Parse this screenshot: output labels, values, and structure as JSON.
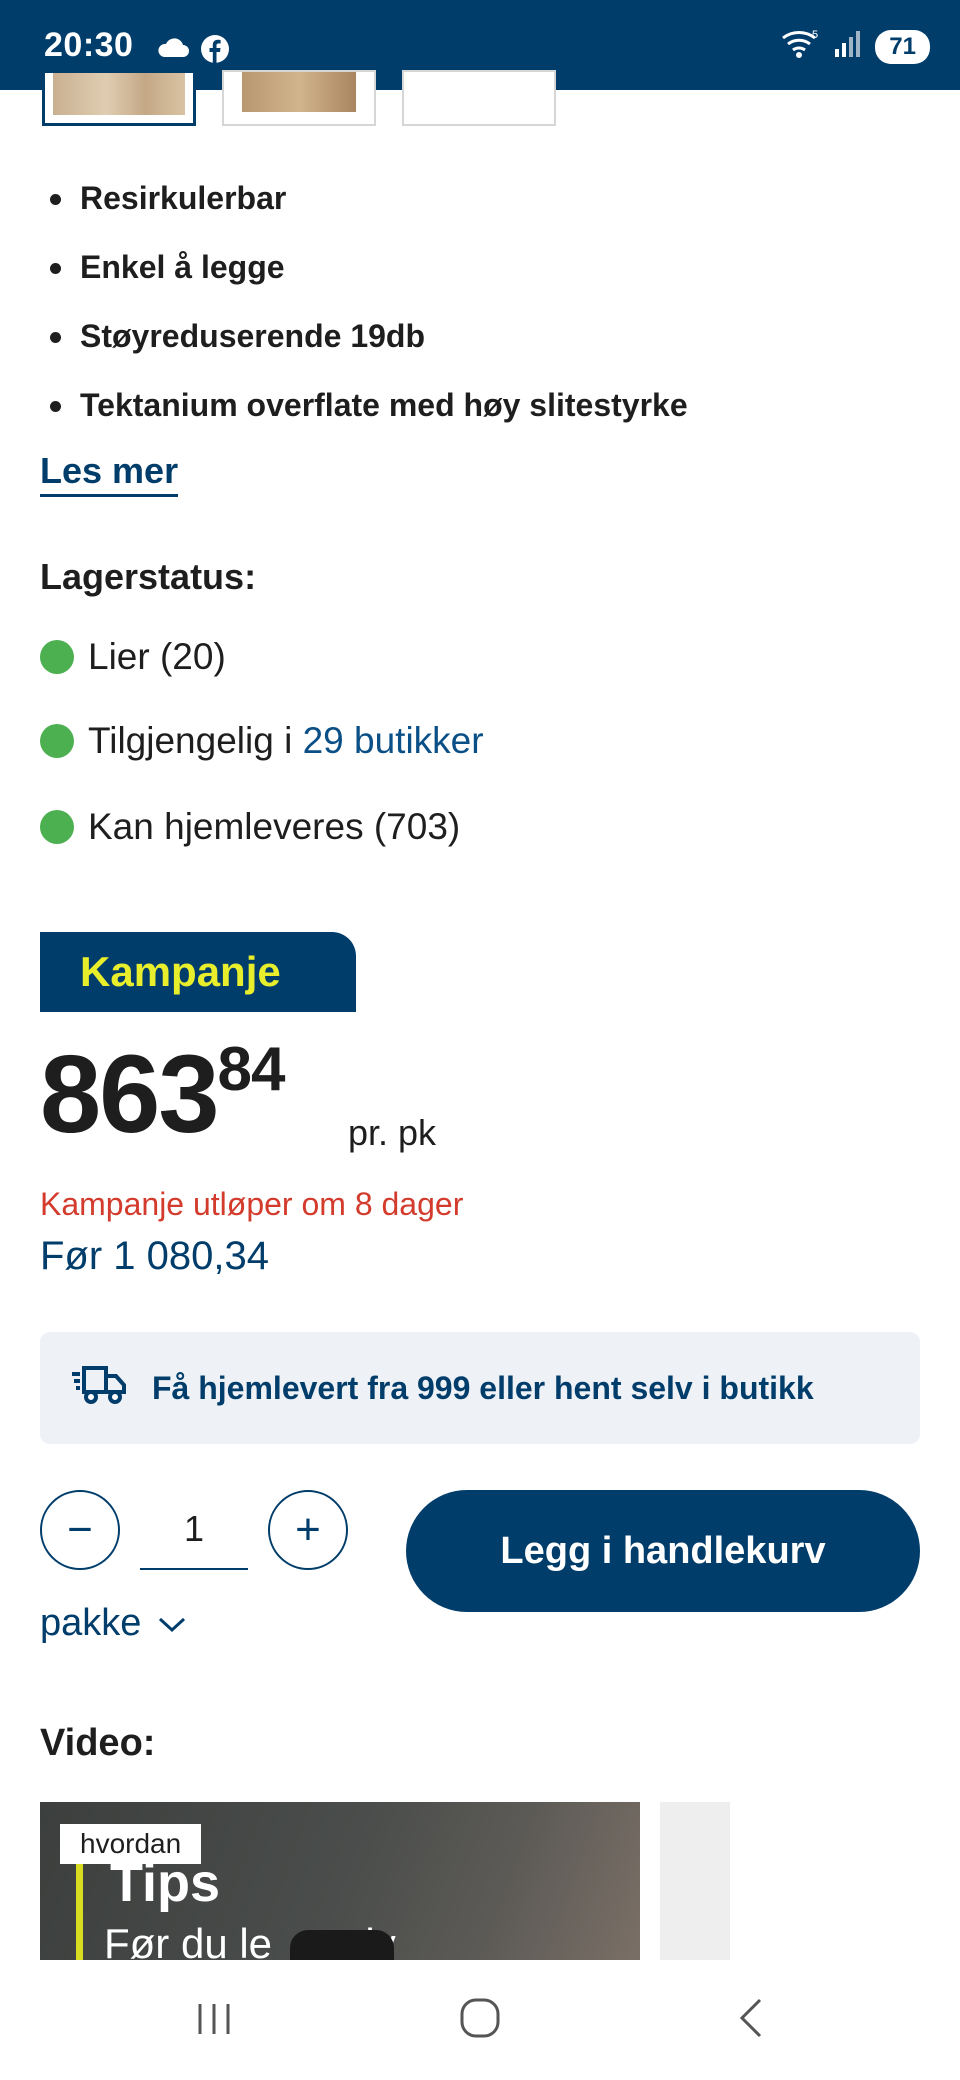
{
  "status_bar": {
    "time": "20:30",
    "battery": "71",
    "wifi_label": "5"
  },
  "features": [
    "Resirkulerbar",
    "Enkel å legge",
    "Støyreduserende 19db",
    "Tektanium overflate med høy slitestyrke"
  ],
  "read_more": "Les mer",
  "stock": {
    "title": "Lagerstatus:",
    "store": "Lier (20)",
    "available_prefix": "Tilgjengelig i ",
    "available_link": "29 butikker",
    "home_delivery": "Kan hjemleveres (703)",
    "indicator_color": "#4caf50"
  },
  "campaign": {
    "badge": "Kampanje",
    "price_main": "863",
    "price_decimals": "84",
    "unit": "pr. pk",
    "expires": "Kampanje utløper om 8 dager",
    "before": "Før 1 080,34"
  },
  "delivery": {
    "text": "Få hjemlevert fra 999 eller hent selv i butikk"
  },
  "cart": {
    "quantity": "1",
    "minus": "−",
    "plus": "+",
    "add_label": "Legg i handlekurv",
    "unit_select": "pakke"
  },
  "video": {
    "title": "Video:",
    "tag": "hvordan",
    "thumb_title": "Tips",
    "thumb_subtitle": "Før du le    gulv"
  },
  "colors": {
    "brand": "#013d6b",
    "accent": "#e8ee2b",
    "alert": "#d33b2c"
  }
}
